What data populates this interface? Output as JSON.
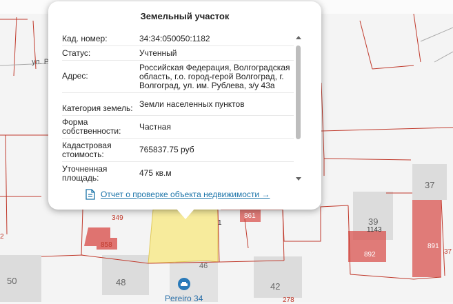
{
  "popup": {
    "title": "Земельный участок",
    "rows": [
      {
        "key": "Кад. номер:",
        "value": "34:34:050050:1182"
      },
      {
        "key": "Статус:",
        "value": "Учтенный"
      },
      {
        "key": "Адрес:",
        "value": "Российская Федерация, Волгоградская область, г.о. город-герой Волгоград, г. Волгоград, ул. им. Рублева, з/у 43а"
      },
      {
        "key": "Категория земель:",
        "value": "Земли населенных пунктов"
      },
      {
        "key": "Форма собственности:",
        "value": "Частная"
      },
      {
        "key": "Кадастровая стоимость:",
        "value": "765837.75 руб"
      },
      {
        "key": "Уточненная площадь:",
        "value": "475 кв.м"
      }
    ],
    "report_link": "Отчет о проверке объекта недвижимости →",
    "report_icon": "document-icon"
  },
  "map": {
    "street_label": "ул. Р",
    "poi_label": "Pereiro 34",
    "poi_icon": "car-service-icon",
    "building_numbers": [
      "50",
      "48",
      "46",
      "42",
      "39",
      "37"
    ],
    "parcel_numbers": [
      "349",
      "858",
      "861",
      "1143",
      "892",
      "891",
      "37",
      "278",
      "1",
      "2"
    ],
    "colors": {
      "parcel_red": "#d9534f",
      "highlight": "#f7eb9c",
      "building": "#d9d9d9"
    }
  }
}
